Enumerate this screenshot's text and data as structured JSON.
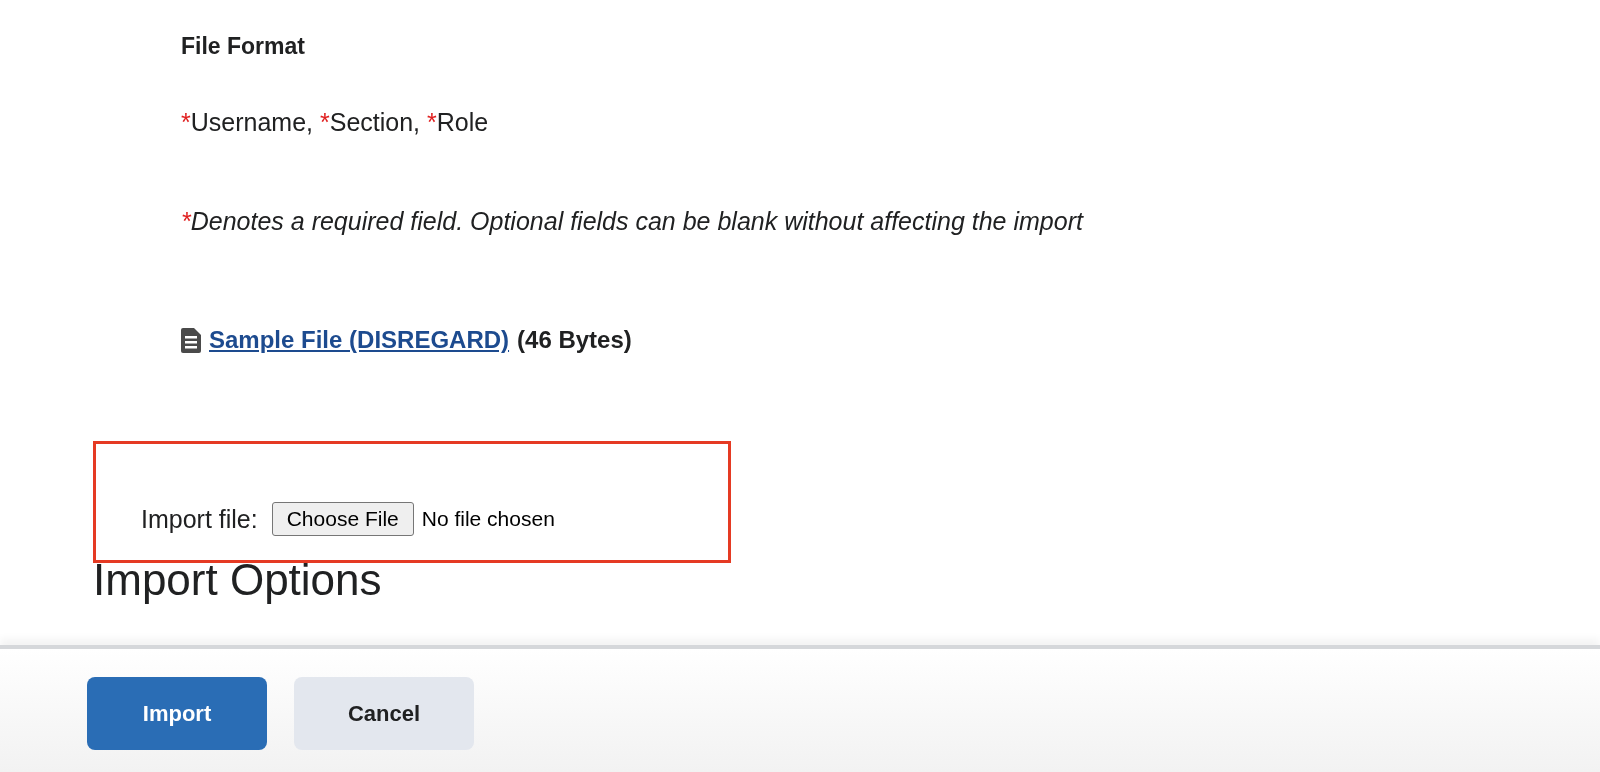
{
  "file_format": {
    "heading": "File Format",
    "fields": [
      {
        "marker": "*",
        "name": "Username,"
      },
      {
        "marker": "*",
        "name": "Section,"
      },
      {
        "marker": "*",
        "name": "Role"
      }
    ],
    "note": {
      "marker": "*",
      "text": "Denotes a required field. Optional fields can be blank without affecting the import"
    },
    "sample": {
      "link": "Sample File (DISREGARD)",
      "size": "(46 Bytes)"
    }
  },
  "import_file": {
    "label": "Import file:",
    "button": "Choose File",
    "status": "No file chosen",
    "highlighted": true
  },
  "import_options": {
    "heading": "Import Options"
  },
  "footer": {
    "buttons": [
      {
        "label": "Import",
        "kind": "primary"
      },
      {
        "label": "Cancel",
        "kind": "secondary"
      }
    ]
  }
}
